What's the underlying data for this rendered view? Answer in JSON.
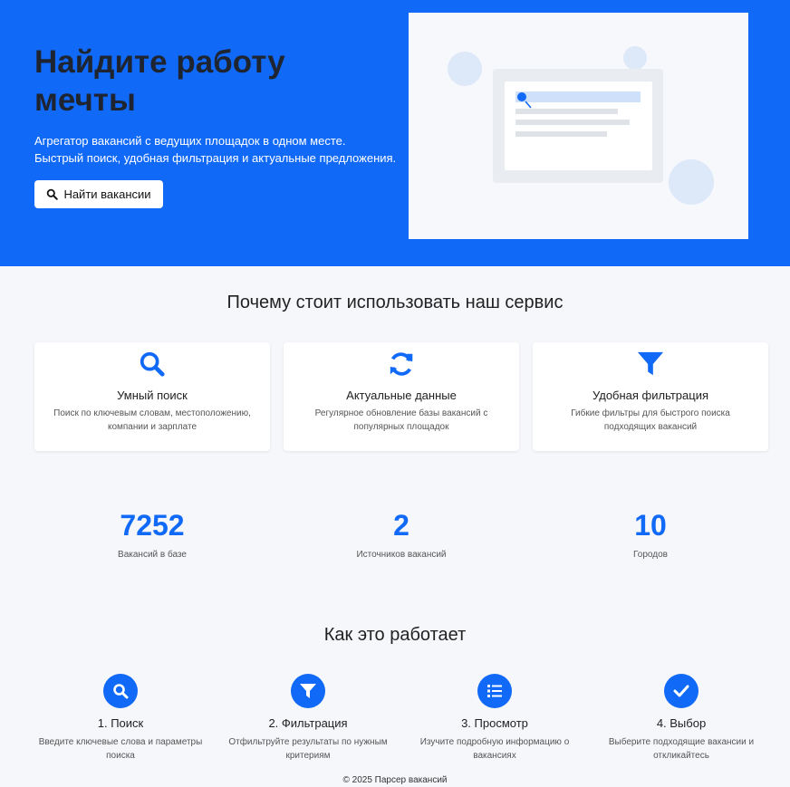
{
  "hero": {
    "title": "Найдите работу мечты",
    "subtitle": "Агрегатор вакансий с ведущих площадок в одном месте. Быстрый поиск, удобная фильтрация и актуальные предложения.",
    "button_label": "Найти вакансии",
    "button_icon": "search-icon"
  },
  "why": {
    "title": "Почему стоит использовать наш сервис",
    "features": [
      {
        "icon": "search-icon",
        "title": "Умный поиск",
        "desc": "Поиск по ключевым словам, местоположению, компании и зарплате"
      },
      {
        "icon": "refresh-icon",
        "title": "Актуальные данные",
        "desc": "Регулярное обновление базы вакансий с популярных площадок"
      },
      {
        "icon": "filter-icon",
        "title": "Удобная фильтрация",
        "desc": "Гибкие фильтры для быстрого поиска подходящих вакансий"
      }
    ]
  },
  "stats": [
    {
      "value": "7252",
      "label": "Вакансий в базе"
    },
    {
      "value": "2",
      "label": "Источников вакансий"
    },
    {
      "value": "10",
      "label": "Городов"
    }
  ],
  "how": {
    "title": "Как это работает",
    "steps": [
      {
        "icon": "search-icon",
        "title": "1. Поиск",
        "desc": "Введите ключевые слова и параметры поиска"
      },
      {
        "icon": "filter-icon",
        "title": "2. Фильтрация",
        "desc": "Отфильтруйте результаты по нужным критериям"
      },
      {
        "icon": "list-icon",
        "title": "3. Просмотр",
        "desc": "Изучите подробную информацию о вакансиях"
      },
      {
        "icon": "check-icon",
        "title": "4. Выбор",
        "desc": "Выберите подходящие вакансии и откликайтесь"
      }
    ]
  },
  "footer": {
    "text": "© 2025 Парсер вакансий"
  },
  "colors": {
    "accent": "#1169f7",
    "background": "#f5f7fa",
    "card": "#ffffff"
  }
}
